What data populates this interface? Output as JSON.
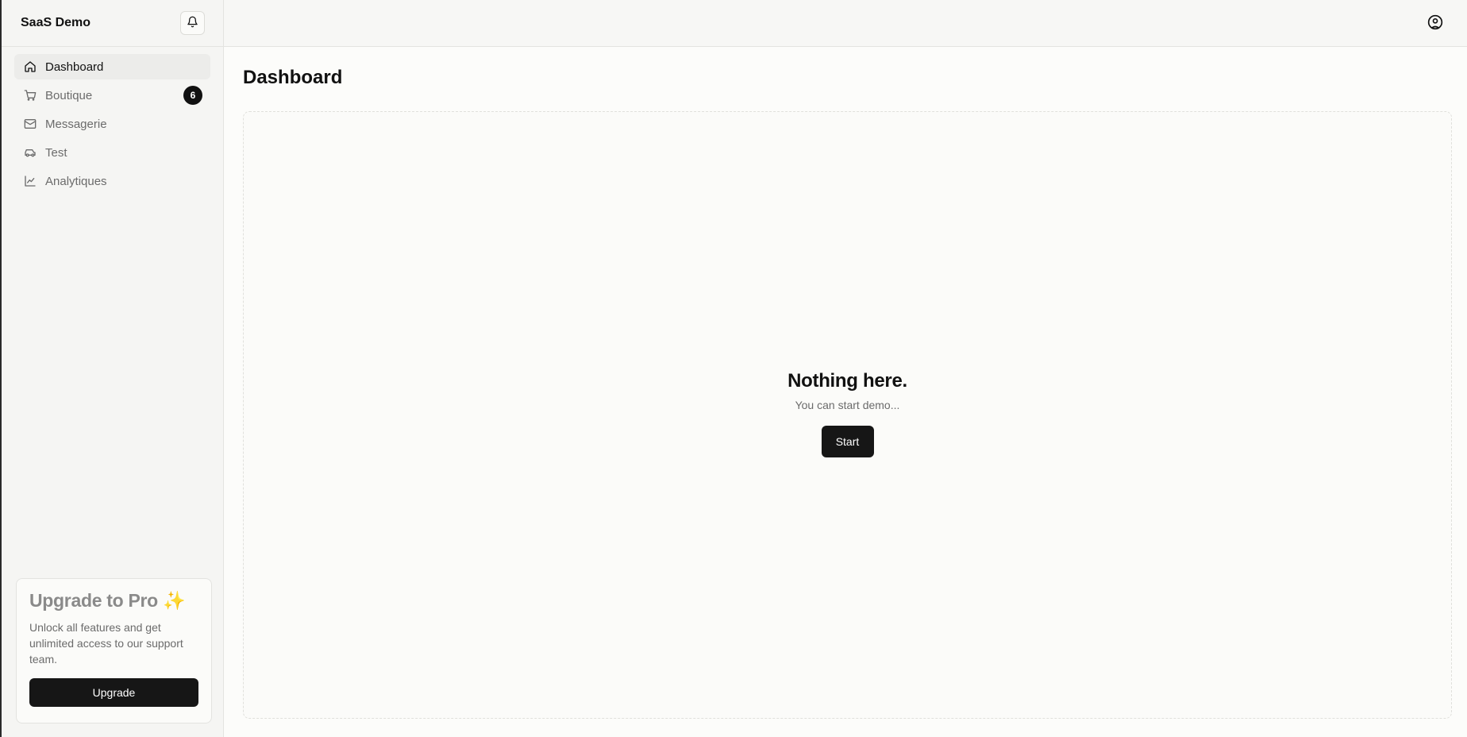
{
  "sidebar": {
    "brand": "SaaS Demo",
    "items": [
      {
        "label": "Dashboard",
        "icon": "home-icon",
        "active": true
      },
      {
        "label": "Boutique",
        "icon": "cart-icon",
        "badge": "6"
      },
      {
        "label": "Messagerie",
        "icon": "mail-icon"
      },
      {
        "label": "Test",
        "icon": "car-icon"
      },
      {
        "label": "Analytiques",
        "icon": "chart-line-icon"
      }
    ],
    "upgrade": {
      "title": "Upgrade to Pro",
      "emoji": "✨",
      "text": "Unlock all features and get unlimited access to our support team.",
      "button": "Upgrade"
    }
  },
  "header": {
    "icons": [
      "bell-icon",
      "user-circle-icon"
    ]
  },
  "main": {
    "title": "Dashboard",
    "empty": {
      "title": "Nothing here.",
      "subtitle": "You can start demo...",
      "button": "Start"
    }
  },
  "colors": {
    "accent": "#161616",
    "background": "#fcfcfa",
    "muted_text": "#6b6b6b"
  }
}
